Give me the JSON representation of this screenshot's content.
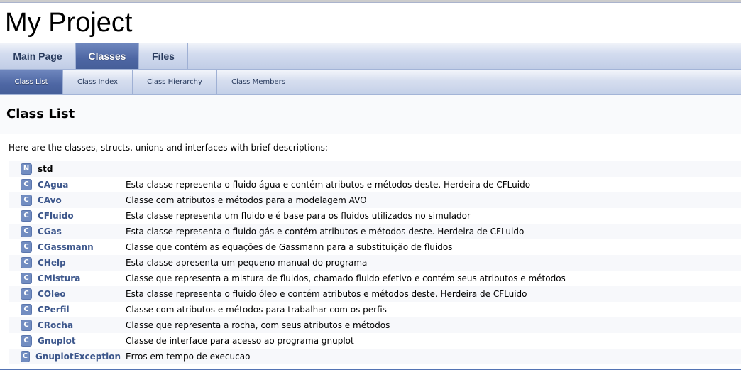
{
  "project": {
    "name": "My Project"
  },
  "tabs": [
    {
      "label": "Main Page"
    },
    {
      "label": "Classes"
    },
    {
      "label": "Files"
    }
  ],
  "subtabs": [
    {
      "label": "Class List"
    },
    {
      "label": "Class Index"
    },
    {
      "label": "Class Hierarchy"
    },
    {
      "label": "Class Members"
    }
  ],
  "header": {
    "title": "Class List"
  },
  "intro": "Here are the classes, structs, unions and interfaces with brief descriptions:",
  "entries": [
    {
      "icon": "N",
      "name": "std",
      "desc": ""
    },
    {
      "icon": "C",
      "name": "CAgua",
      "desc": "Esta classe representa o fluido água e contém atributos e métodos deste. Herdeira de CFLuido"
    },
    {
      "icon": "C",
      "name": "CAvo",
      "desc": "Classe com atributos e métodos para a modelagem AVO"
    },
    {
      "icon": "C",
      "name": "CFluido",
      "desc": "Esta classe representa um fluido e é base para os fluidos utilizados no simulador"
    },
    {
      "icon": "C",
      "name": "CGas",
      "desc": "Esta classe representa o fluido gás e contém atributos e métodos deste. Herdeira de CFLuido"
    },
    {
      "icon": "C",
      "name": "CGassmann",
      "desc": "Classe que contém as equações de Gassmann para a substituição de fluidos"
    },
    {
      "icon": "C",
      "name": "CHelp",
      "desc": "Esta classe apresenta um pequeno manual do programa"
    },
    {
      "icon": "C",
      "name": "CMistura",
      "desc": "Classe que representa a mistura de fluidos, chamado fluido efetivo e contém seus atributos e métodos"
    },
    {
      "icon": "C",
      "name": "COleo",
      "desc": "Esta classe representa o fluido óleo e contém atributos e métodos deste. Herdeira de CFLuido"
    },
    {
      "icon": "C",
      "name": "CPerfil",
      "desc": "Classe com atributos e métodos para trabalhar com os perfis"
    },
    {
      "icon": "C",
      "name": "CRocha",
      "desc": "Classe que representa a rocha, com seus atributos e métodos"
    },
    {
      "icon": "C",
      "name": "Gnuplot",
      "desc": "Classe de interface para acesso ao programa gnuplot"
    },
    {
      "icon": "C",
      "name": "GnuplotException",
      "desc": "Erros em tempo de execucao"
    }
  ]
}
